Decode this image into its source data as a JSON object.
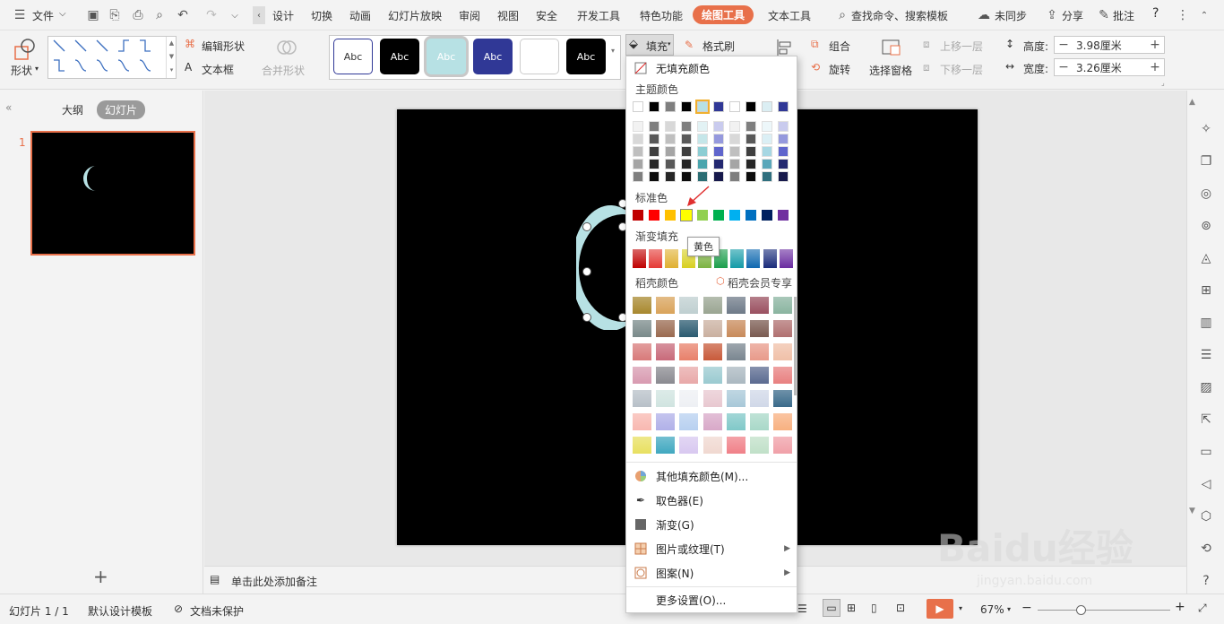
{
  "menubar": {
    "file": "文件",
    "tabs": [
      "设计",
      "切换",
      "动画",
      "幻灯片放映",
      "审阅",
      "视图",
      "安全",
      "开发工具",
      "特色功能",
      "绘图工具",
      "文本工具"
    ],
    "search": "查找命令、搜索模板",
    "sync": "未同步",
    "share": "分享",
    "comment": "批注",
    "help": "?"
  },
  "ribbon": {
    "shape": "形状",
    "edit_shape": "编辑形状",
    "textbox": "文本框",
    "merge_shape": "合并形状",
    "style_label": "Abc",
    "fill": "填充",
    "format_painter": "格式刷",
    "group": "组合",
    "rotate": "旋转",
    "selection_pane": "选择窗格",
    "bring_forward": "上移一层",
    "send_backward": "下移一层",
    "height_label": "高度:",
    "height_value": "3.98厘米",
    "width_label": "宽度:",
    "width_value": "3.26厘米"
  },
  "left_panel": {
    "outline_tab": "大纲",
    "slides_tab": "幻灯片",
    "slide_number": "1",
    "add": "+"
  },
  "notes": {
    "placeholder": "单击此处添加备注"
  },
  "status": {
    "slide_info": "幻灯片 1 / 1",
    "template": "默认设计模板",
    "protect": "文档未保护",
    "zoom": "67%"
  },
  "dropdown": {
    "no_fill": "无填充颜色",
    "theme_colors": "主题颜色",
    "standard_colors": "标准色",
    "gradient_fill": "渐变填充",
    "daoke_colors": "稻壳颜色",
    "daoke_member": "稻壳会员专享",
    "tooltip": "黄色",
    "more_colors": "其他填充颜色(M)...",
    "eyedropper": "取色器(E)",
    "gradient": "渐变(G)",
    "picture_texture": "图片或纹理(T)",
    "pattern": "图案(N)",
    "more_settings": "更多设置(O)..."
  },
  "colors": {
    "accent": "#e8704a",
    "theme_row": [
      "#ffffff",
      "#000000",
      "#7f7f7f",
      "#000000",
      "#b7e1e4",
      "#303896",
      "#ffffff",
      "#000000",
      "#dbeef3",
      "#303896"
    ],
    "standard": [
      "#c00000",
      "#ff0000",
      "#ffc000",
      "#ffff00",
      "#92d050",
      "#00b050",
      "#00b0f0",
      "#0070c0",
      "#002060",
      "#7030a0"
    ],
    "shape_fill": "#b7e1e4"
  },
  "watermark": {
    "brand": "Baidu经验",
    "url": "jingyan.baidu.com"
  }
}
